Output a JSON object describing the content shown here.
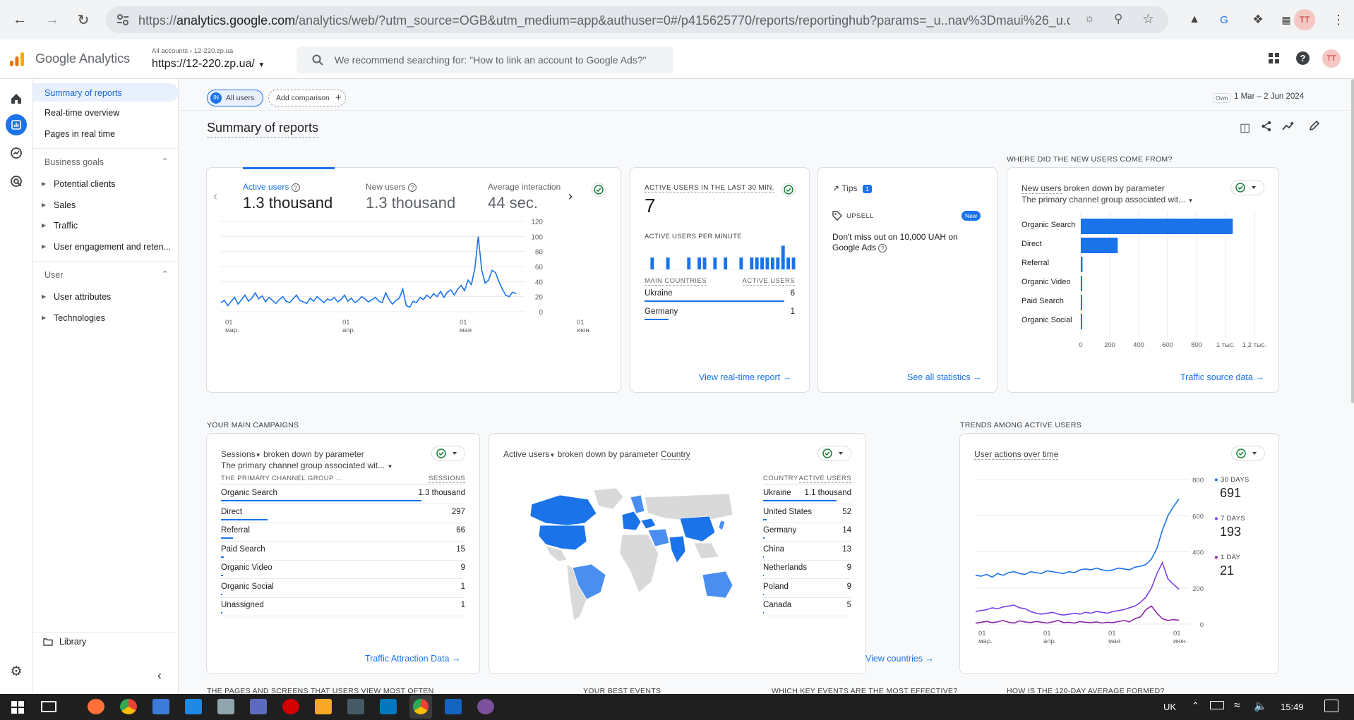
{
  "browser": {
    "url_prefix": "https://",
    "url_host": "analytics.google.com",
    "url_rest": "/analytics/web/?utm_source=OGB&utm_medium=app&authuser=0#/p415625770/reports/reportinghub?params=_u..nav%3Dmaui%26_u.co..."
  },
  "app": {
    "logo_text": "Google Analytics",
    "account_crumb_all": "All accounts",
    "account_crumb_sub": "12-220.zp.ua",
    "property": "https://12-220.zp.ua/",
    "search_placeholder": "We recommend searching for: \"How to link an account to Google Ads?\"",
    "avatar_text": "ТТ"
  },
  "nav": {
    "summary": "Summary of reports",
    "realtime": "Real-time overview",
    "pages_rt": "Pages in real time",
    "business_goals": "Business goals",
    "potential_clients": "Potential clients",
    "sales": "Sales",
    "traffic": "Traffic",
    "engagement": "User engagement and reten...",
    "user": "User",
    "user_attributes": "User attributes",
    "technologies": "Technologies",
    "library": "Library"
  },
  "top": {
    "all_users_badge": "IN",
    "all_users": "All users",
    "add_comparison": "Add comparison",
    "date_own": "Own",
    "date_range": "1 Mar – 2 Jun 2024",
    "page_title": "Summary of reports"
  },
  "kpi": {
    "active_label": "Active users",
    "active_value": "1.3 thousand",
    "new_label": "New users",
    "new_value": "1.3 thousand",
    "avg_label": "Average interaction",
    "avg_value": "44 sec."
  },
  "realtime": {
    "title": "ACTIVE USERS IN THE LAST 30 MIN.",
    "value": "7",
    "per_minute": "ACTIVE USERS PER MINUTE",
    "col_country": "MAIN COUNTRIES",
    "col_users": "ACTIVE USERS",
    "rows": [
      {
        "name": "Ukraine",
        "value": "6"
      },
      {
        "name": "Germany",
        "value": "1"
      }
    ],
    "link": "View real-time report"
  },
  "tips": {
    "title": "Tips",
    "count": "1",
    "tag": "UPSELL",
    "new": "New",
    "text": "Don't miss out on 10,000 UAH on Google Ads",
    "link": "See all statistics"
  },
  "sources": {
    "section": "WHERE DID THE NEW USERS COME FROM?",
    "title_metric": "New users",
    "title_rest": "broken down by parameter",
    "dimension": "The primary channel group associated wit...",
    "link": "Traffic source data"
  },
  "campaigns": {
    "section": "YOUR MAIN CAMPAIGNS",
    "title_metric": "Sessions",
    "title_rest": "broken down by parameter",
    "dimension": "The primary channel group associated wit...",
    "col_group": "THE PRIMARY CHANNEL GROUP ...",
    "col_sessions": "SESSIONS",
    "rows": [
      {
        "name": "Organic Search",
        "value": "1.3 thousand",
        "share": 0.82
      },
      {
        "name": "Direct",
        "value": "297",
        "share": 0.19
      },
      {
        "name": "Referral",
        "value": "66",
        "share": 0.05
      },
      {
        "name": "Paid Search",
        "value": "15",
        "share": 0.012
      },
      {
        "name": "Organic Video",
        "value": "9",
        "share": 0.008
      },
      {
        "name": "Organic Social",
        "value": "1",
        "share": 0.003
      },
      {
        "name": "Unassigned",
        "value": "1",
        "share": 0.003
      }
    ],
    "link": "Traffic Attraction Data"
  },
  "countries": {
    "title_metric": "Active users",
    "title_rest": "broken down by parameter",
    "dimension": "Country",
    "col_country": "COUNTRY",
    "col_users": "ACTIVE USERS",
    "rows": [
      {
        "name": "Ukraine",
        "value": "1.1 thousand",
        "share": 0.83
      },
      {
        "name": "United States",
        "value": "52",
        "share": 0.04
      },
      {
        "name": "Germany",
        "value": "14",
        "share": 0.012
      },
      {
        "name": "China",
        "value": "13",
        "share": 0.011
      },
      {
        "name": "Netherlands",
        "value": "9",
        "share": 0.008
      },
      {
        "name": "Poland",
        "value": "9",
        "share": 0.008
      },
      {
        "name": "Canada",
        "value": "5",
        "share": 0.005
      }
    ],
    "link": "View countries"
  },
  "trends": {
    "section": "TRENDS AMONG ACTIVE USERS",
    "title": "User actions over time",
    "legend": [
      {
        "label": "30 DAYS",
        "value": "691",
        "color": "#1a73e8"
      },
      {
        "label": "7 DAYS",
        "value": "193",
        "color": "#7b3fe4"
      },
      {
        "label": "1 DAY",
        "value": "21",
        "color": "#8e24aa"
      }
    ]
  },
  "bottom_sections": {
    "pages": "THE PAGES AND SCREENS THAT USERS VIEW MOST OFTEN",
    "events": "YOUR BEST EVENTS",
    "key_events": "WHICH KEY EVENTS ARE THE MOST EFFECTIVE?",
    "avg120": "HOW IS THE 120-DAY AVERAGE FORMED?"
  },
  "taskbar": {
    "lang": "UK",
    "time": "15:49"
  },
  "colors": {
    "accent": "#1a73e8",
    "map_dark": "#1a73e8",
    "map_mid": "#4a8ef0",
    "map_none": "#d9d9d9"
  },
  "chart_data": [
    {
      "type": "line",
      "name": "active_users_daily",
      "x_ticks": [
        "01 мар.",
        "01 апр.",
        "01 мая",
        "01 июн."
      ],
      "y_ticks": [
        0,
        20,
        40,
        60,
        80,
        100,
        120
      ],
      "ylim": [
        0,
        120
      ],
      "values": [
        12,
        15,
        8,
        14,
        19,
        10,
        16,
        22,
        14,
        18,
        25,
        17,
        21,
        13,
        19,
        15,
        11,
        16,
        20,
        14,
        12,
        17,
        22,
        15,
        13,
        11,
        18,
        14,
        20,
        16,
        12,
        17,
        15,
        19,
        13,
        16,
        22,
        14,
        18,
        12,
        15,
        20,
        17,
        13,
        16,
        19,
        14,
        12,
        25,
        16,
        10,
        15,
        18,
        30,
        8,
        6,
        14,
        12,
        19,
        16,
        22,
        18,
        24,
        20,
        27,
        19,
        26,
        29,
        22,
        30,
        35,
        28,
        42,
        36,
        58,
        100,
        55,
        38,
        42,
        55,
        52,
        40,
        30,
        22,
        20,
        26,
        24
      ]
    },
    {
      "type": "bar",
      "name": "active_users_per_minute",
      "values": [
        0,
        4,
        0,
        0,
        4,
        0,
        0,
        0,
        4,
        0,
        4,
        4,
        0,
        4,
        0,
        4,
        0,
        0,
        4,
        0,
        4,
        4,
        4,
        4,
        4,
        4,
        8,
        4,
        4
      ]
    },
    {
      "type": "bar",
      "orientation": "horizontal",
      "name": "new_users_by_channel",
      "categories": [
        "Organic Search",
        "Direct",
        "Referral",
        "Organic Video",
        "Paid Search",
        "Organic Social"
      ],
      "values": [
        1050,
        255,
        12,
        10,
        8,
        2
      ],
      "x_ticks": [
        "0",
        "200",
        "400",
        "600",
        "800",
        "1 тыс.",
        "1,2 тыс."
      ],
      "xlim": [
        0,
        1200
      ]
    },
    {
      "type": "line",
      "name": "user_actions_over_time",
      "x_ticks": [
        "01 мар.",
        "01 апр.",
        "01 мая",
        "01 июн."
      ],
      "y_ticks": [
        0,
        200,
        400,
        600,
        800
      ],
      "ylim": [
        0,
        800
      ],
      "series": [
        {
          "name": "30 DAYS",
          "values": [
            270,
            265,
            275,
            260,
            280,
            270,
            285,
            290,
            280,
            275,
            290,
            285,
            280,
            295,
            290,
            285,
            280,
            290,
            285,
            300,
            305,
            300,
            310,
            300,
            295,
            300,
            310,
            305,
            300,
            315,
            320,
            330,
            360,
            420,
            520,
            600,
            650,
            691
          ]
        },
        {
          "name": "7 DAYS",
          "values": [
            70,
            75,
            80,
            90,
            85,
            95,
            100,
            105,
            90,
            85,
            70,
            60,
            55,
            60,
            65,
            55,
            50,
            55,
            60,
            55,
            65,
            60,
            70,
            65,
            60,
            70,
            75,
            80,
            90,
            100,
            120,
            150,
            200,
            280,
            340,
            250,
            220,
            193
          ]
        },
        {
          "name": "1 DAY",
          "values": [
            5,
            10,
            15,
            8,
            12,
            20,
            10,
            6,
            18,
            12,
            8,
            15,
            10,
            6,
            12,
            20,
            8,
            10,
            6,
            14,
            10,
            8,
            12,
            6,
            10,
            8,
            14,
            20,
            12,
            30,
            40,
            80,
            100,
            60,
            30,
            20,
            25,
            21
          ]
        }
      ]
    }
  ]
}
